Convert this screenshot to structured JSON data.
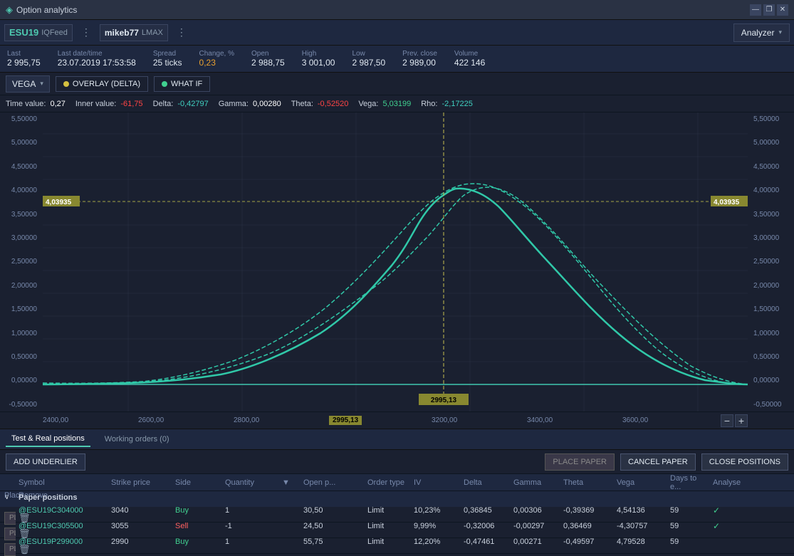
{
  "titleBar": {
    "title": "Option analytics",
    "iconColor": "#4ec9b0",
    "minimizeLabel": "—",
    "restoreLabel": "❐",
    "closeLabel": "✕"
  },
  "topBar": {
    "symbol": "ESU19",
    "feed": "IQFeed",
    "account": "mikeb77",
    "broker": "LMAX",
    "analyzer": "Analyzer"
  },
  "quoteBar": {
    "last_label": "Last",
    "last_value": "2 995,75",
    "datetime_label": "Last date/time",
    "datetime_value": "23.07.2019 17:53:58",
    "spread_label": "Spread",
    "spread_value": "25 ticks",
    "change_label": "Change, %",
    "change_value": "0,23",
    "open_label": "Open",
    "open_value": "2 988,75",
    "high_label": "High",
    "high_value": "3 001,00",
    "low_label": "Low",
    "low_value": "2 987,50",
    "prevclose_label": "Prev. close",
    "prevclose_value": "2 989,00",
    "volume_label": "Volume",
    "volume_value": "422 146"
  },
  "controls": {
    "vegaLabel": "VEGA",
    "overlayLabel": "OVERLAY (DELTA)",
    "whatifLabel": "WHAT IF"
  },
  "infoBar": {
    "timeValue_label": "Time value:",
    "timeValue": "0,27",
    "innerValue_label": "Inner value:",
    "innerValue": "-61,75",
    "delta_label": "Delta:",
    "delta": "-0,42797",
    "gamma_label": "Gamma:",
    "gamma": "0,00280",
    "theta_label": "Theta:",
    "theta": "-0,52520",
    "vega_label": "Vega:",
    "vega": "5,03199",
    "rho_label": "Rho:",
    "rho": "-2,17225"
  },
  "chart": {
    "yAxisLeft": [
      "5,50000",
      "5,00000",
      "4,50000",
      "4,00000",
      "3,50000",
      "3,00000",
      "2,50000",
      "2,00000",
      "1,50000",
      "1,00000",
      "0,50000",
      "0,00000",
      "-0,50000"
    ],
    "yAxisRight": [
      "5,50000",
      "5,00000",
      "4,50000",
      "4,00000",
      "3,50000",
      "3,00000",
      "2,50000",
      "2,00000",
      "1,50000",
      "1,00000",
      "0,50000",
      "0,00000",
      "-0,50000"
    ],
    "xAxis": [
      "2400,00",
      "2600,00",
      "2800,00",
      "2995,13",
      "3200,00",
      "3400,00",
      "3600,00"
    ],
    "refLineLabel": "4,03935",
    "cursorLabel": "2995,13",
    "accentColor": "#40c8b0"
  },
  "positionsTabs": {
    "testReal": "Test & Real positions",
    "workingOrders": "Working orders (0)"
  },
  "actionButtons": {
    "addUnderlier": "ADD UNDERLIER",
    "placePaper": "PLACE PAPER",
    "cancelPaper": "CANCEL PAPER",
    "closePositions": "CLOSE POSITIONS"
  },
  "table": {
    "headers": [
      "",
      "Symbol",
      "Strike price",
      "Side",
      "Quantity",
      "",
      "Open p...",
      "Order type",
      "IV",
      "Delta",
      "Gamma",
      "Theta",
      "Vega",
      "Days to e...",
      "Analyse",
      "Place",
      "Remove"
    ],
    "groupLabel": "Paper positions",
    "rows": [
      {
        "symbol": "@ESU19C304000",
        "strike": "3040",
        "side": "Buy",
        "qty": "1",
        "openp": "30,50",
        "ordertype": "Limit",
        "iv": "10,23%",
        "delta": "0,36845",
        "gamma": "0,00306",
        "theta": "-0,39369",
        "vega": "4,54136",
        "days": "59",
        "hasCheck": true,
        "placeActive": false
      },
      {
        "symbol": "@ESU19C305500",
        "strike": "3055",
        "side": "Sell",
        "qty": "-1",
        "openp": "24,50",
        "ordertype": "Limit",
        "iv": "9,99%",
        "delta": "-0,32006",
        "gamma": "-0,00297",
        "theta": "0,36469",
        "vega": "-4,30757",
        "days": "59",
        "hasCheck": true,
        "placeActive": false
      },
      {
        "symbol": "@ESU19P299000",
        "strike": "2990",
        "side": "Buy",
        "qty": "1",
        "openp": "55,75",
        "ordertype": "Limit",
        "iv": "12,20%",
        "delta": "-0,47461",
        "gamma": "0,00271",
        "theta": "-0,49597",
        "vega": "4,79528",
        "days": "59",
        "hasCheck": false,
        "placeActive": false
      }
    ]
  }
}
